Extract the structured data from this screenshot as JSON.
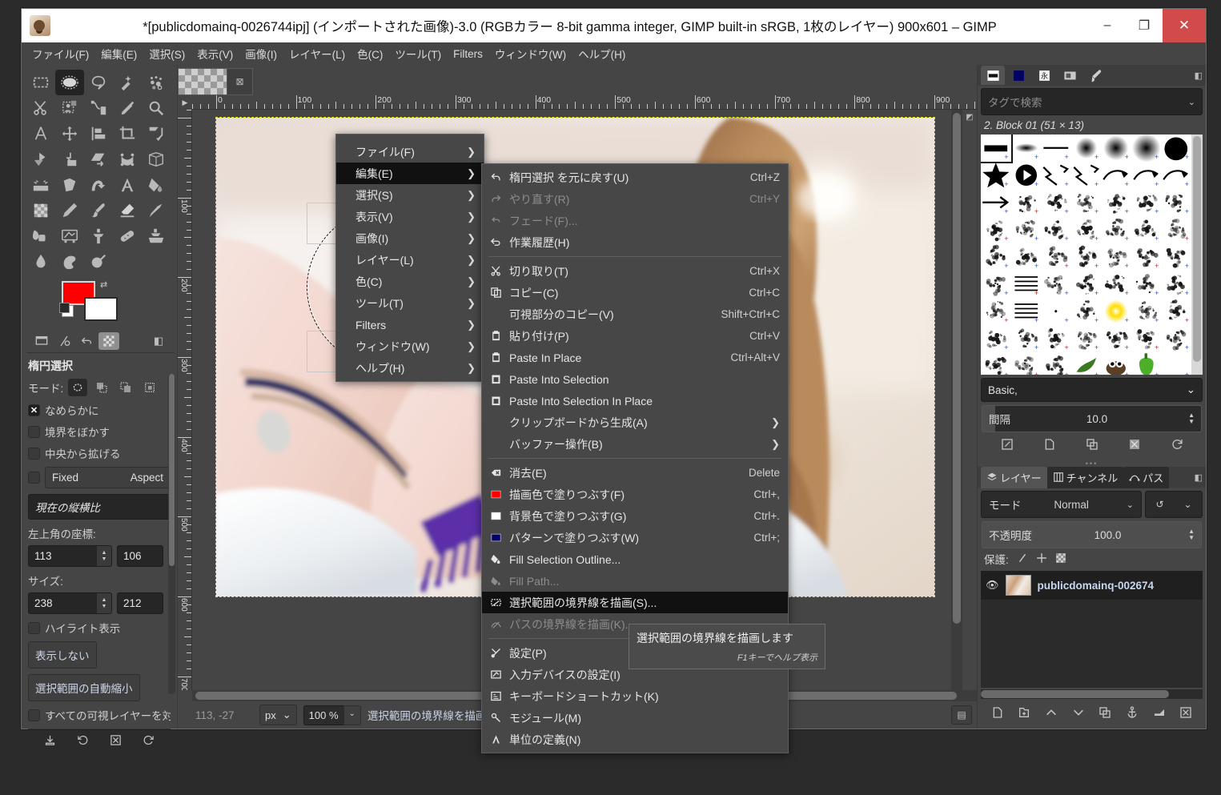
{
  "window": {
    "title": "*[publicdomainq-0026744ipj] (インポートされた画像)-3.0 (RGBカラー 8-bit gamma integer, GIMP built-in sRGB, 1枚のレイヤー) 900x601 – GIMP",
    "minimize": "–",
    "maximize": "❐",
    "close": "✕"
  },
  "menubar": [
    "ファイル(F)",
    "編集(E)",
    "選択(S)",
    "表示(V)",
    "画像(I)",
    "レイヤー(L)",
    "色(C)",
    "ツール(T)",
    "Filters",
    "ウィンドウ(W)",
    "ヘルプ(H)"
  ],
  "tool_options": {
    "title": "楕円選択",
    "mode_label": "モード:",
    "antialias_label": "なめらかに",
    "feather_label": "境界をぼかす",
    "expand_label": "中央から拡げる",
    "fixed_label": "Fixed",
    "fixed_value": "Aspect",
    "ratio_value": "現在の縦横比",
    "position_label": "左上角の座標:",
    "position_x": "113",
    "position_y": "106",
    "size_label": "サイズ:",
    "size_w": "238",
    "size_h": "212",
    "highlight_label": "ハイライト表示",
    "guides_value": "表示しない",
    "auto_shrink_label": "選択範囲の自動縮小",
    "all_layers_label": "すべての可視レイヤーを対象"
  },
  "canvas": {
    "ruler_h_labels": [
      "0",
      "100",
      "200",
      "300",
      "400",
      "500",
      "600",
      "700",
      "800",
      "900"
    ],
    "ruler_v_labels": [
      "0",
      "100",
      "200",
      "300",
      "400",
      "500",
      "600"
    ]
  },
  "statusbar": {
    "position": "113, -27",
    "unit": "px",
    "zoom": "100 %",
    "message": "選択範囲の境界線を描画..."
  },
  "brushes_panel": {
    "search_placeholder": "タグで検索",
    "brush_name": "2. Block 01 (51 × 13)",
    "brush_combo": "Basic,",
    "spacing_label": "間隔",
    "spacing_value": "10.0"
  },
  "layers_panel": {
    "tabs": [
      {
        "label": "レイヤー",
        "icon": "layers-icon",
        "active": true
      },
      {
        "label": "チャンネル",
        "icon": "channels-icon",
        "active": false
      },
      {
        "label": "パス",
        "icon": "paths-icon",
        "active": false
      }
    ],
    "mode_label": "モード",
    "mode_value": "Normal",
    "opacity_label": "不透明度",
    "opacity_value": "100.0",
    "lock_label": "保護:",
    "layer_name": "publicdomainq-002674"
  },
  "menu_root": {
    "items": [
      {
        "label": "ファイル(F)",
        "submenu": true,
        "highlight": false
      },
      {
        "label": "編集(E)",
        "submenu": true,
        "highlight": true
      },
      {
        "label": "選択(S)",
        "submenu": true,
        "highlight": false
      },
      {
        "label": "表示(V)",
        "submenu": true,
        "highlight": false
      },
      {
        "label": "画像(I)",
        "submenu": true,
        "highlight": false
      },
      {
        "label": "レイヤー(L)",
        "submenu": true,
        "highlight": false
      },
      {
        "label": "色(C)",
        "submenu": true,
        "highlight": false
      },
      {
        "label": "ツール(T)",
        "submenu": true,
        "highlight": false
      },
      {
        "label": "Filters",
        "submenu": true,
        "highlight": false
      },
      {
        "label": "ウィンドウ(W)",
        "submenu": true,
        "highlight": false
      },
      {
        "label": "ヘルプ(H)",
        "submenu": true,
        "highlight": false
      }
    ]
  },
  "menu_edit": {
    "items": [
      {
        "kind": "item",
        "icon": "undo-icon",
        "label": "楕円選択 を元に戻す(U)",
        "accel": "Ctrl+Z",
        "disabled": false
      },
      {
        "kind": "item",
        "icon": "redo-icon",
        "label": "やり直す(R)",
        "accel": "Ctrl+Y",
        "disabled": true
      },
      {
        "kind": "item",
        "icon": "fade-icon",
        "label": "フェード(F)...",
        "accel": "",
        "disabled": true
      },
      {
        "kind": "item",
        "icon": "history-icon",
        "label": "作業履歴(H)",
        "accel": "",
        "disabled": false
      },
      {
        "kind": "sep"
      },
      {
        "kind": "item",
        "icon": "cut-icon",
        "label": "切り取り(T)",
        "accel": "Ctrl+X",
        "disabled": false
      },
      {
        "kind": "item",
        "icon": "copy-icon",
        "label": "コピー(C)",
        "accel": "Ctrl+C",
        "disabled": false
      },
      {
        "kind": "item",
        "icon": "none",
        "label": "可視部分のコピー(V)",
        "accel": "Shift+Ctrl+C",
        "disabled": false
      },
      {
        "kind": "item",
        "icon": "paste-icon",
        "label": "貼り付け(P)",
        "accel": "Ctrl+V",
        "disabled": false
      },
      {
        "kind": "item",
        "icon": "paste-icon",
        "label": "Paste In Place",
        "accel": "Ctrl+Alt+V",
        "disabled": false
      },
      {
        "kind": "item",
        "icon": "paste-sel-icon",
        "label": "Paste Into Selection",
        "accel": "",
        "disabled": false
      },
      {
        "kind": "item",
        "icon": "paste-sel-icon",
        "label": "Paste Into Selection In Place",
        "accel": "",
        "disabled": false
      },
      {
        "kind": "sub",
        "icon": "none",
        "label": "クリップボードから生成(A)",
        "accel": "",
        "disabled": false
      },
      {
        "kind": "sub",
        "icon": "none",
        "label": "バッファー操作(B)",
        "accel": "",
        "disabled": false
      },
      {
        "kind": "sep"
      },
      {
        "kind": "item",
        "icon": "erase-icon",
        "label": "消去(E)",
        "accel": "Delete",
        "disabled": false
      },
      {
        "kind": "item",
        "icon": "swatch-fg",
        "label": "描画色で塗りつぶす(F)",
        "accel": "Ctrl+,",
        "disabled": false
      },
      {
        "kind": "item",
        "icon": "swatch-bg",
        "label": "背景色で塗りつぶす(G)",
        "accel": "Ctrl+.",
        "disabled": false
      },
      {
        "kind": "item",
        "icon": "swatch-pattern",
        "label": "パターンで塗りつぶす(W)",
        "accel": "Ctrl+;",
        "disabled": false
      },
      {
        "kind": "item",
        "icon": "fill-outline-icon",
        "label": "Fill Selection Outline...",
        "accel": "",
        "disabled": false
      },
      {
        "kind": "item",
        "icon": "fill-path-icon",
        "label": "Fill Path...",
        "accel": "",
        "disabled": true
      },
      {
        "kind": "item",
        "icon": "stroke-sel-icon",
        "label": "選択範囲の境界線を描画(S)...",
        "accel": "",
        "disabled": false,
        "highlight": true
      },
      {
        "kind": "item",
        "icon": "stroke-path-icon",
        "label": "パスの境界線を描画(K)...",
        "accel": "",
        "disabled": true
      },
      {
        "kind": "sep"
      },
      {
        "kind": "item",
        "icon": "prefs-icon",
        "label": "設定(P)",
        "accel": "",
        "disabled": false
      },
      {
        "kind": "item",
        "icon": "input-dev-icon",
        "label": "入力デバイスの設定(I)",
        "accel": "",
        "disabled": false
      },
      {
        "kind": "item",
        "icon": "keyboard-icon",
        "label": "キーボードショートカット(K)",
        "accel": "",
        "disabled": false
      },
      {
        "kind": "item",
        "icon": "module-icon",
        "label": "モジュール(M)",
        "accel": "",
        "disabled": false
      },
      {
        "kind": "item",
        "icon": "units-icon",
        "label": "単位の定義(N)",
        "accel": "",
        "disabled": false
      }
    ]
  },
  "tooltip": {
    "text": "選択範囲の境界線を描画します",
    "hint": "F1キーでヘルプ表示"
  },
  "colors": {
    "foreground": "#fe0000",
    "background": "#ffffff",
    "pattern": "#000066",
    "highlight_menu": "#111111",
    "selection_outline": "#e8e800"
  }
}
